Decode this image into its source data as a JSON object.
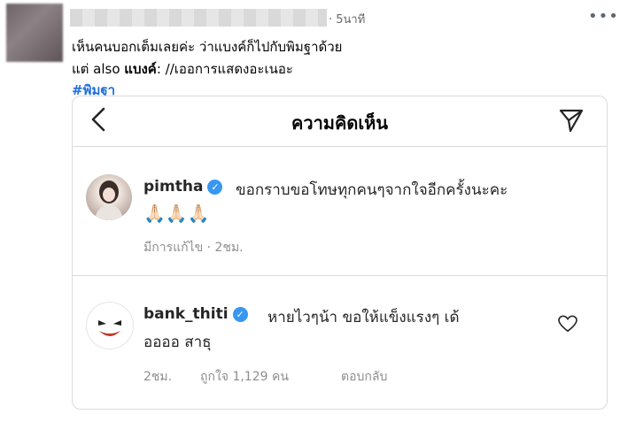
{
  "post": {
    "time": "· 5นาที",
    "line1": "เห็นคนบอกเต็มเลยค่ะ ว่าแบงค์ก็ไปกับพิมฐาด้วย",
    "line2_prefix": "แต่ also ",
    "line2_bold": "แบงค์",
    "line2_suffix": ":  //เออการแสดงอะเนอะ",
    "hashtag": "#พิมฐา"
  },
  "screenshot": {
    "title": "ความคิดเห็น",
    "comments": [
      {
        "username": "pimtha",
        "text_line1": "ขอกราบขอโทษทุกคนๆจากใจอีกครั้งนะคะ",
        "text_line2": "🙏🏻🙏🏻🙏🏻",
        "meta": "มีการแก้ไข · 2ชม."
      },
      {
        "username": "bank_thiti",
        "text_line1": "หายไวๆน้า ขอให้แข็งแรงๆ เด้",
        "text_line2": "ออออ สาธุ",
        "time": "2ชม.",
        "likes": "ถูกใจ 1,129 คน",
        "reply": "ตอบกลับ"
      }
    ]
  },
  "icons": [
    "more-icon",
    "back-icon",
    "send-icon",
    "verified-icon",
    "heart-icon"
  ],
  "colors": {
    "hashtag": "#216fdb",
    "verified": "#3897f0",
    "muted": "#8e8e8e"
  }
}
